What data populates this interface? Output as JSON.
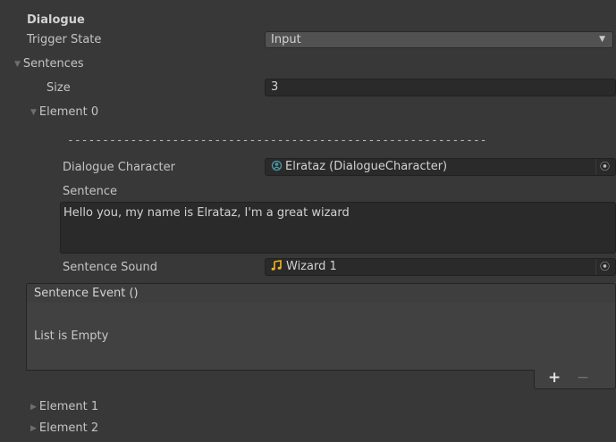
{
  "component": {
    "title": "Dialogue"
  },
  "trigger_state": {
    "label": "Trigger State",
    "value": "Input"
  },
  "sentences": {
    "label": "Sentences",
    "size_label": "Size",
    "size_value": "3",
    "element0": {
      "label": "Element 0",
      "divider": "------------------------------------------------------------",
      "dialogue_character_label": "Dialogue Character",
      "dialogue_character_value": "Elrataz (DialogueCharacter)",
      "sentence_label": "Sentence",
      "sentence_text": "Hello you, my name is Elrataz, I'm a great wizard",
      "sentence_sound_label": "Sentence Sound",
      "sentence_sound_value": "Wizard 1",
      "event": {
        "header": "Sentence Event ()",
        "empty_text": "List is Empty",
        "add_label": "+",
        "remove_label": "−"
      }
    },
    "element1": {
      "label": "Element 1"
    },
    "element2": {
      "label": "Element 2"
    }
  },
  "colors": {
    "background": "#383838",
    "field": "#2a2a2a",
    "dropdown": "#515151",
    "sound_icon": "#f0b81e",
    "character_icon": "#4a9aa8"
  },
  "icons": {
    "foldout_expanded": "triangle-down-icon",
    "foldout_collapsed": "triangle-right-icon",
    "dropdown_arrow": "chevron-down-icon",
    "object_picker": "target-icon",
    "character": "character-asset-icon",
    "sound": "music-note-icon"
  }
}
